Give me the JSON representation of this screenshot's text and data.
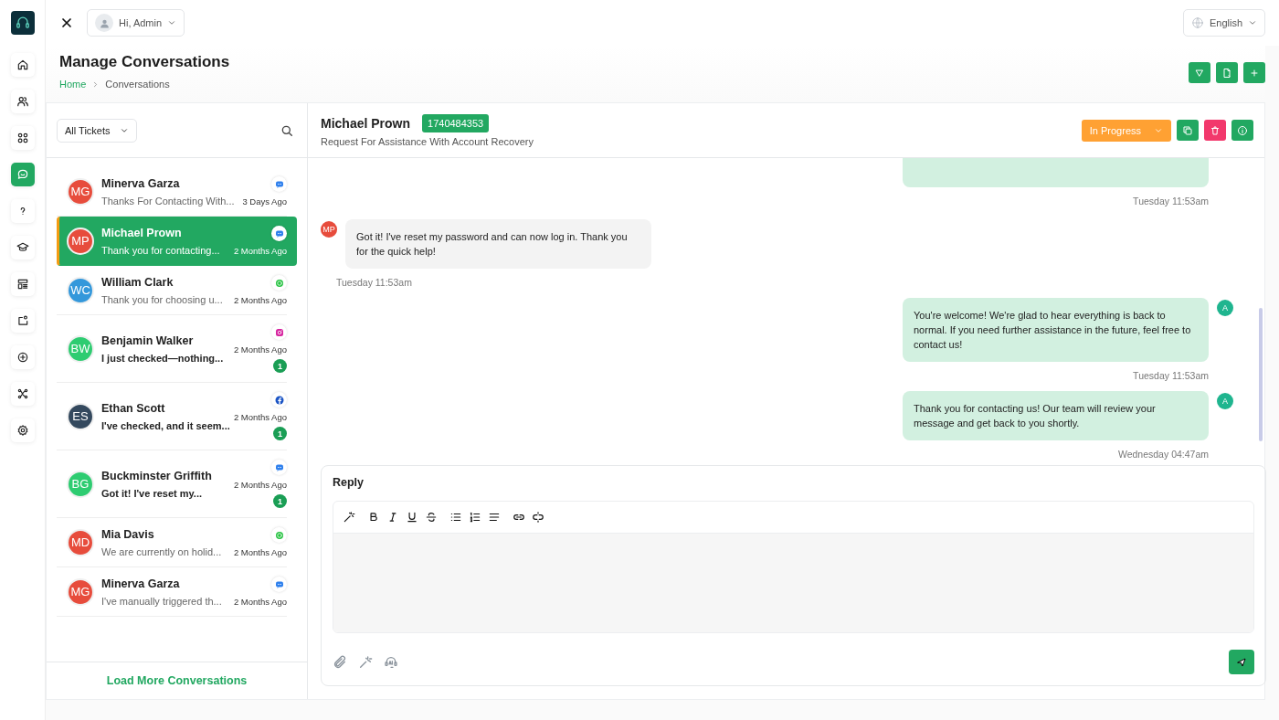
{
  "topbar": {
    "user_menu": {
      "label": "Hi, Admin"
    },
    "language": {
      "label": "English"
    }
  },
  "sidebar": {
    "items": [
      {
        "selected": false
      },
      {
        "selected": false
      },
      {
        "selected": false
      },
      {
        "selected": true
      },
      {
        "selected": false
      },
      {
        "selected": false
      },
      {
        "selected": false
      },
      {
        "selected": false
      },
      {
        "selected": false
      },
      {
        "selected": false
      },
      {
        "selected": false
      }
    ]
  },
  "page": {
    "title": "Manage Conversations",
    "breadcrumb": [
      {
        "label": "Home",
        "kind": "link"
      },
      {
        "label": "Conversations",
        "kind": "current"
      }
    ]
  },
  "conversations": {
    "filter": {
      "label": "All Tickets"
    },
    "items": [
      {
        "initials": "MG",
        "name": "Minerva Garza",
        "preview": "Thanks For Contacting With...",
        "time": "3 Days Ago",
        "kind": "chat",
        "color": "#e74c3c",
        "selected": false
      },
      {
        "initials": "MP",
        "name": "Michael Prown",
        "preview": "Thank you for contacting...",
        "time": "2 Months Ago",
        "kind": "chat",
        "color": "#e74c3c",
        "selected": true
      },
      {
        "initials": "WC",
        "name": "William Clark",
        "preview": "Thank you for choosing u...",
        "time": "2 Months Ago",
        "kind": "whatsapp",
        "color": "#3498db",
        "selected": false
      },
      {
        "initials": "BW",
        "name": "Benjamin Walker",
        "preview": "I just checked—nothing...",
        "time": "2 Months Ago",
        "kind": "instagram",
        "color": "#2ecc71",
        "selected": false,
        "unread": "1"
      },
      {
        "initials": "ES",
        "name": "Ethan Scott",
        "preview": "I've checked, and it seem...",
        "time": "2 Months Ago",
        "kind": "facebook",
        "color": "#34495e",
        "selected": false,
        "unread": "1"
      },
      {
        "initials": "BG",
        "name": "Buckminster Griffith",
        "preview": "Got it! I've reset my...",
        "time": "2 Months Ago",
        "kind": "chat",
        "color": "#2ecc71",
        "selected": false,
        "unread": "1"
      },
      {
        "initials": "MD",
        "name": "Mia Davis",
        "preview": "We are currently on holid...",
        "time": "2 Months Ago",
        "kind": "whatsapp",
        "color": "#e74c3c",
        "selected": false
      },
      {
        "initials": "MG",
        "name": "Minerva Garza",
        "preview": "I've manually triggered th...",
        "time": "2 Months Ago",
        "kind": "chat",
        "color": "#e74c3c",
        "selected": false
      }
    ],
    "load_more": "Load More Conversations"
  },
  "chat": {
    "name": "Michael Prown",
    "ticket_id": "1740484353",
    "subject": "Request For Assistance With Account Recovery",
    "status": {
      "label": "In Progress"
    },
    "messages": [
      {
        "kind": "outgoing",
        "cut": true,
        "time": "Tuesday 11:53am"
      },
      {
        "kind": "incoming",
        "cut": false,
        "initials": "MP",
        "color": "#e74c3c",
        "text": "Got it! I've reset my password and can now log in. Thank you for the quick help!",
        "time": "Tuesday 11:53am"
      },
      {
        "kind": "outgoing",
        "cut": false,
        "initials": "A",
        "color": "#1fb58f",
        "text": "You're welcome! We're glad to hear everything is back to normal. If you need further assistance in the future, feel free to contact us!",
        "time": "Tuesday 11:53am"
      },
      {
        "kind": "outgoing",
        "cut": false,
        "initials": "A",
        "color": "#1fb58f",
        "text": "Thank you for contacting us! Our team will review your message and get back to you shortly.",
        "time": "Wednesday 04:47am"
      }
    ],
    "reply": {
      "title": "Reply"
    }
  }
}
